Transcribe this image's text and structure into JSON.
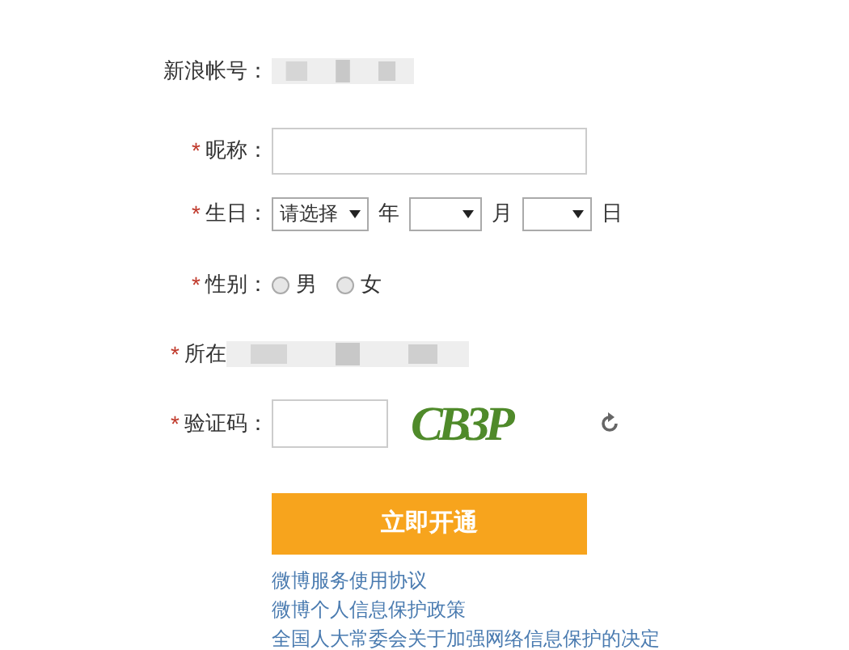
{
  "account": {
    "label": "新浪帐号："
  },
  "nickname": {
    "label": "昵称："
  },
  "birthday": {
    "label": "生日：",
    "year_select": "请选择",
    "year_unit": "年",
    "month_unit": "月",
    "day_unit": "日"
  },
  "gender": {
    "label": "性别：",
    "options": [
      {
        "label": "男",
        "selected": false
      },
      {
        "label": "女",
        "selected": false
      }
    ]
  },
  "location": {
    "label": "所在"
  },
  "captcha": {
    "label": "验证码：",
    "image_text": "CB3P"
  },
  "required_mark": "*",
  "submit": "立即开通",
  "links": [
    "微博服务使用协议",
    "微博个人信息保护政策",
    "全国人大常委会关于加强网络信息保护的决定"
  ]
}
